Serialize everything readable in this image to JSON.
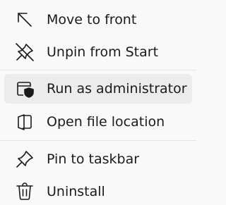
{
  "menu": {
    "items": [
      {
        "label": "Move to front",
        "icon": "arrow-up-left-icon"
      },
      {
        "label": "Unpin from Start",
        "icon": "unpin-icon"
      },
      {
        "label": "Run as administrator",
        "icon": "shield-window-icon",
        "highlighted": true
      },
      {
        "label": "Open file location",
        "icon": "folder-open-icon"
      },
      {
        "label": "Pin to taskbar",
        "icon": "pin-icon"
      },
      {
        "label": "Uninstall",
        "icon": "trash-icon"
      }
    ]
  },
  "colors": {
    "background": "#f9f9f9",
    "hover": "#ececec",
    "separator": "#e3e3e3",
    "text": "#1b1b1b"
  }
}
